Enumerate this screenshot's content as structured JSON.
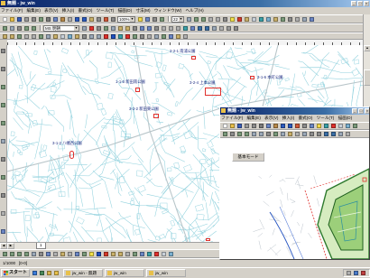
{
  "colors": {
    "title_bar": "#0a246a",
    "map_line": "#92d2de",
    "marker": "#e0302c",
    "park_green": "#2d7a2d"
  },
  "main": {
    "title": "無題 - jw_win",
    "menu": [
      "ファイル(F)",
      "編集(E)",
      "表示(V)",
      "挿入(I)",
      "書式(O)",
      "ツール(T)",
      "描画(D)",
      "寸法(M)",
      "ウィンドウ(W)",
      "ヘルプ(H)"
    ],
    "toolbar1": {
      "icons_a": [
        "new-icon",
        "open-icon",
        "save-icon",
        "print-icon",
        "preview-icon",
        "spell-icon",
        "cut-icon",
        "copy-icon",
        "paste-icon",
        "format-painter-icon",
        "undo-icon",
        "redo-icon",
        "hyperlink-icon",
        "table-icon",
        "chart-icon",
        "drawing-icon"
      ],
      "zoom": "100%",
      "icons_b": [
        "help-icon",
        "arrow-icon",
        "line-icon",
        "rect-icon"
      ],
      "size": "22",
      "icons_c": [
        "bold-icon",
        "italic-icon",
        "underline-icon",
        "align-left-icon",
        "align-center-icon",
        "align-right-icon",
        "fill-color-icon",
        "font-color-icon",
        "border-icon",
        "grid-icon",
        "layer-icon",
        "snap-icon",
        "ortho-icon",
        "measure-icon",
        "erase-icon",
        "move-icon",
        "rotate-icon",
        "mirror-icon"
      ]
    },
    "toolbar2": {
      "icons_a": [
        "select-icon",
        "text-icon",
        "line-icon",
        "arc-icon",
        "circle-icon"
      ],
      "font": "MS 明朝",
      "icons_b": [
        "pen-icon",
        "color-icon",
        "hatch-icon",
        "dimension-icon",
        "offset-icon",
        "trim-icon",
        "extend-icon",
        "fillet-icon",
        "copy-icon",
        "array-icon",
        "scale-icon",
        "stretch-icon",
        "explode-icon",
        "group-icon",
        "layer-icon",
        "property-icon",
        "zoom-in-icon",
        "zoom-out-icon",
        "pan-icon",
        "refresh-icon",
        "print-icon",
        "close-icon"
      ]
    },
    "toolbar3": {
      "icons": [
        "point-icon",
        "vertex-icon",
        "midpoint-icon",
        "center-icon",
        "intersection-icon",
        "perpendicular-icon",
        "tangent-icon",
        "nearest-icon",
        "grid-icon",
        "snap-icon",
        "ortho-icon",
        "polar-icon",
        "osnap-icon",
        "track-icon",
        "red-flag-icon",
        "blue-flag-icon",
        "layer-icon",
        "color-icon",
        "linetype-icon",
        "lineweight-icon",
        "plot-icon",
        "match-icon",
        "measure-icon",
        "area-icon",
        "list-icon",
        "id-icon"
      ]
    },
    "left_tools": [
      "cursor-icon",
      "line-icon",
      "rect-icon",
      "circle-icon",
      "arc-icon",
      "text-icon",
      "hatch-icon",
      "dimension-icon",
      "erase-icon",
      "move-icon",
      "copy-icon",
      "zoom-icon"
    ],
    "map_labels": [
      "2-2-1 南浦公園",
      "1-1-5 新田南公園",
      "3-2-4 上本公園",
      "3-1-6 本町公園",
      "3-2-2 新田東公園",
      "3-1-2 八幡西公園"
    ],
    "sheet_tab": "1",
    "bottom_toolbar": {
      "icons": [
        "draw-icon",
        "select-icon",
        "rect-icon",
        "circle-icon",
        "text-icon",
        "line-icon",
        "arrow-icon",
        "shape-icon",
        "textbox-icon",
        "wordart-icon",
        "clipart-icon",
        "picture-icon",
        "fill-color-icon",
        "line-color-icon",
        "font-color-icon",
        "line-style-icon",
        "dash-style-icon",
        "arrow-style-icon",
        "shadow-icon",
        "3d-icon",
        "layer-icon",
        "color-icon",
        "grid-icon",
        "snap-icon"
      ]
    },
    "status": {
      "scale": "1/1000",
      "layer": "[0-0]"
    }
  },
  "sub": {
    "title": "無題 - jw_win",
    "menu": [
      "ファイル(F)",
      "編集(E)",
      "表示(V)",
      "挿入(I)",
      "書式(O)",
      "ツール(T)",
      "描画(D)"
    ],
    "toolbar1": {
      "icons": [
        "new-icon",
        "open-icon",
        "save-icon",
        "print-icon",
        "preview-icon",
        "cut-icon",
        "copy-icon",
        "paste-icon",
        "undo-icon",
        "redo-icon",
        "chart-icon",
        "table-icon",
        "zoom-icon",
        "help-icon",
        "layer-icon",
        "color-icon",
        "grid-icon",
        "snap-icon",
        "measure-icon"
      ]
    },
    "toolbar2": {
      "icons": [
        "select-icon",
        "line-icon",
        "arc-icon",
        "circle-icon",
        "text-icon",
        "pen-icon",
        "hatch-icon",
        "dimension-icon",
        "offset-icon",
        "trim-icon",
        "move-icon",
        "rotate-icon",
        "scale-icon",
        "erase-icon",
        "zoom-in-icon",
        "zoom-out-icon",
        "pan-icon",
        "refresh-icon"
      ]
    },
    "mode_button": "基本モード"
  },
  "taskbar": {
    "start": "スタート",
    "quick_launch": [
      "ie-icon",
      "desktop-icon",
      "outlook-icon",
      "folder-icon"
    ],
    "tasks": [
      "jw_win - 無題",
      "jw_win",
      "jw_win"
    ],
    "tray": [
      "volume-icon",
      "network-icon",
      "ime-icon"
    ]
  }
}
